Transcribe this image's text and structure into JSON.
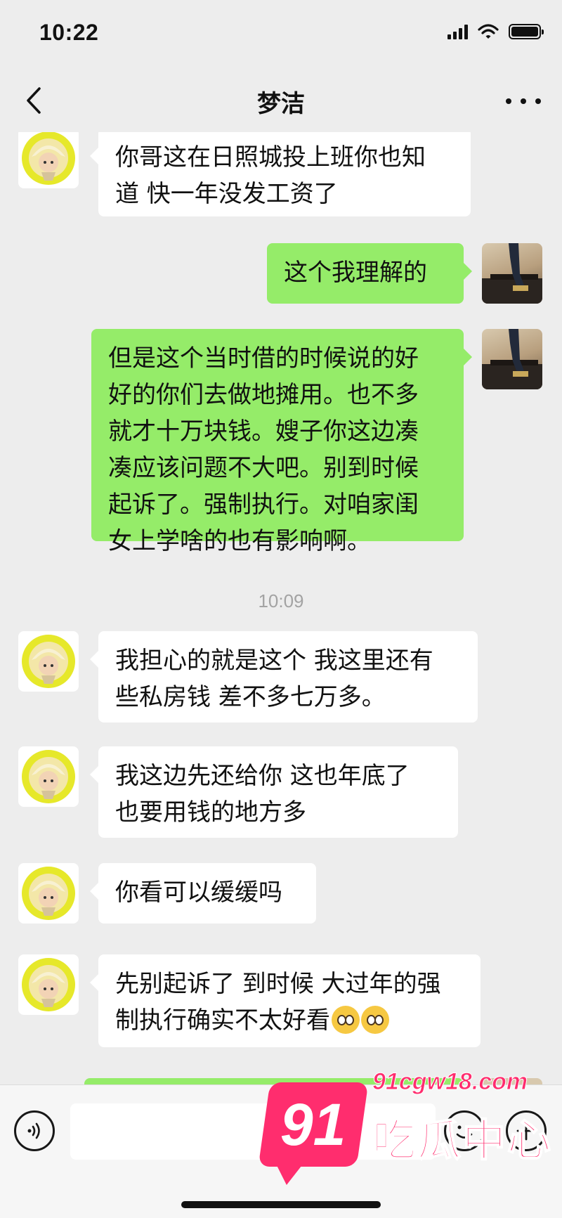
{
  "status_bar": {
    "time": "10:22",
    "icons": [
      "signal-icon",
      "wifi-icon",
      "battery-icon"
    ]
  },
  "nav": {
    "title": "梦洁",
    "back_icon": "chevron-left-icon",
    "more_icon": "more-dots-icon"
  },
  "messages": [
    {
      "side": "left",
      "text": "你哥这在日照城投上班你也知\n道 快一年没发工资了"
    },
    {
      "side": "right",
      "text": "这个我理解的"
    },
    {
      "side": "right",
      "text": "但是这个当时借的时候说的好\n好的你们去做地摊用。也不多\n就才十万块钱。嫂子你这边凑\n凑应该问题不大吧。别到时候\n起诉了。强制执行。对咱家闺\n女上学啥的也有影响啊。"
    },
    {
      "side": "left",
      "text": "我担心的就是这个 我这里还有\n些私房钱 差不多七万多。"
    },
    {
      "side": "left",
      "text": "我这边先还给你 这也年底了\n也要用钱的地方多"
    },
    {
      "side": "left",
      "text": "你看可以缓缓吗"
    },
    {
      "side": "left",
      "text": "先别起诉了 到时候 大过年的强\n制执行确实不太好看",
      "emojis": [
        "worried-face-emoji",
        "worried-face-emoji"
      ]
    }
  ],
  "timestamp": "10:09",
  "input_bar": {
    "placeholder": "",
    "voice_icon": "voice-icon",
    "emoji_icon": "emoji-icon",
    "plus_icon": "plus-icon"
  },
  "watermark": {
    "number": "91",
    "url": "91cgw18.com",
    "name": "吃瓜中心",
    "color": "#ff2d6e"
  },
  "colors": {
    "background": "#ededed",
    "bubble_self": "#95ec69",
    "bubble_other": "#ffffff"
  }
}
